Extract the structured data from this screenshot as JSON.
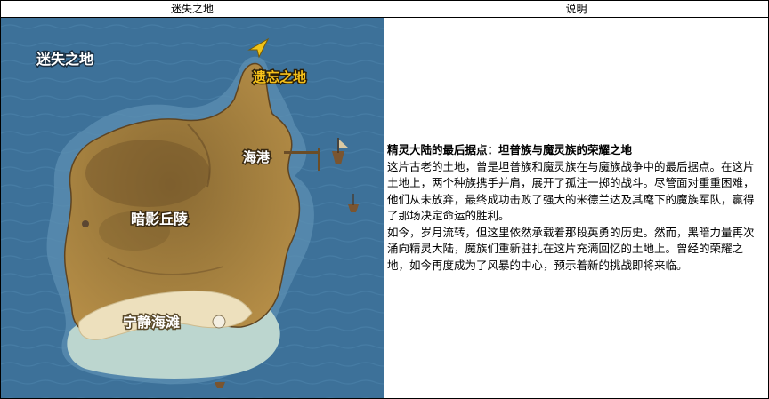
{
  "table": {
    "header_left": "迷失之地",
    "header_right": "说明"
  },
  "map": {
    "region_name": "迷失之地",
    "marker_label": "遗忘之地",
    "areas": {
      "harbor": "海港",
      "shadow_hills": "暗影丘陵",
      "tranquil_beach": "宁静海滩"
    },
    "colors": {
      "sea": "#3d7199",
      "land": "#a8823d",
      "land_dark": "#6e5227",
      "beach": "#ede0bd",
      "shallow": "#bcd6cf",
      "marker": "#f0c419"
    }
  },
  "description": {
    "title": "精灵大陆的最后据点：坦普族与魔灵族的荣耀之地",
    "paragraphs": [
      "这片古老的土地，曾是坦普族和魔灵族在与魔族战争中的最后据点。在这片土地上，两个种族携手并肩，展开了孤注一掷的战斗。尽管面对重重困难，他们从未放弃，最终成功击败了强大的米德兰达及其麾下的魔族军队，赢得了那场决定命运的胜利。",
      "如今，岁月流转，但这里依然承载着那段英勇的历史。然而，黑暗力量再次涌向精灵大陆，魔族们重新驻扎在这片充满回忆的土地上。曾经的荣耀之地，如今再度成为了风暴的中心，预示着新的挑战即将来临。"
    ]
  }
}
